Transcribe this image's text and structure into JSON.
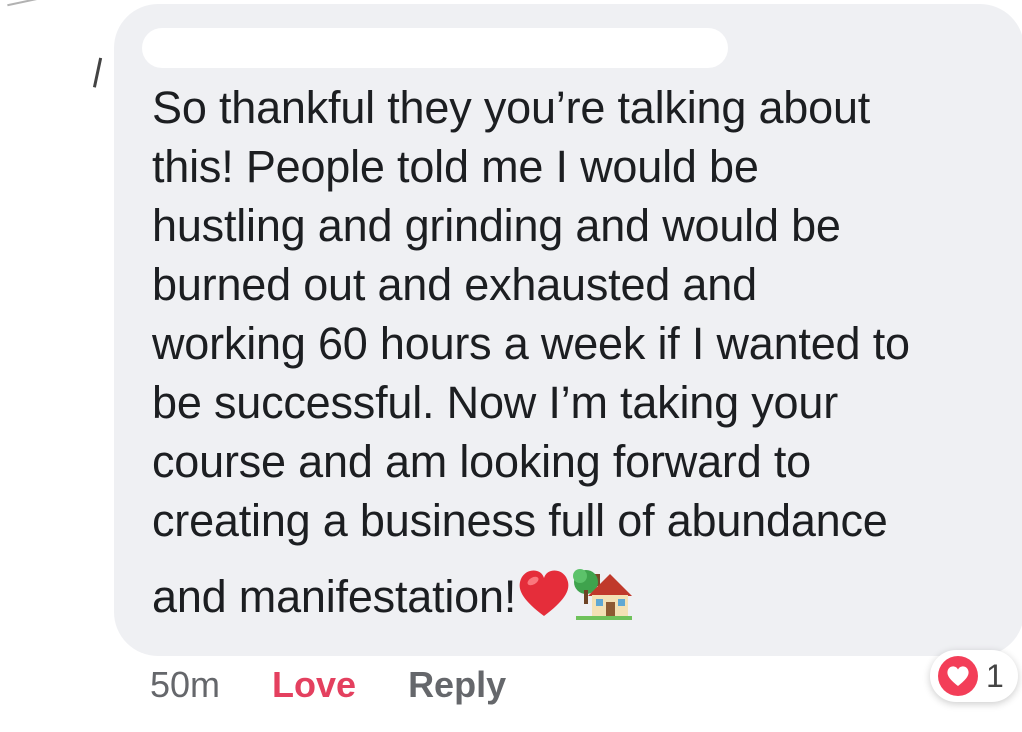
{
  "comment": {
    "lines": [
      "So thankful they you’re talking about",
      "this! People told me I would be",
      "hustling and grinding and would be",
      "burned out and exhausted and",
      "working 60 hours a week if I wanted to",
      "be successful. Now I’m taking your",
      "course and am looking forward to",
      "creating a business full of abundance",
      "and manifestation!"
    ],
    "emojis": [
      "heart-emoji",
      "house-with-garden-emoji"
    ]
  },
  "actions": {
    "timestamp": "50m",
    "love_label": "Love",
    "reply_label": "Reply"
  },
  "reaction": {
    "icon": "love-reaction-icon",
    "count": "1"
  },
  "colors": {
    "bubble": "#eff0f3",
    "text": "#1c1e21",
    "love": "#e4405f",
    "muted": "#65676b",
    "reaction": "#f33e58"
  }
}
